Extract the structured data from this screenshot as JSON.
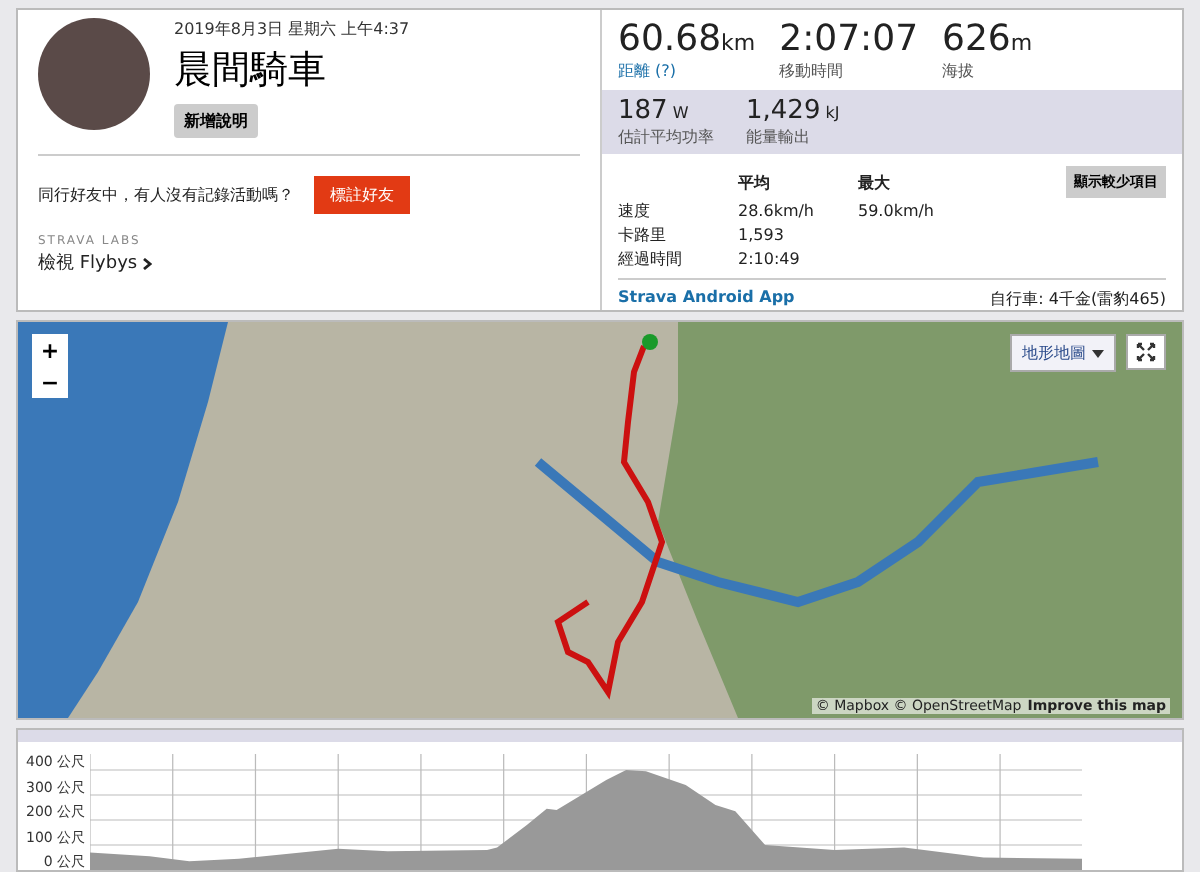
{
  "activity": {
    "date": "2019年8月3日 星期六 上午4:37",
    "title": "晨間騎車",
    "add_description": "新增說明"
  },
  "friends": {
    "prompt": "同行好友中，有人沒有記錄活動嗎？",
    "button": "標註好友"
  },
  "labs": {
    "label": "STRAVA LABS",
    "link": "檢視 Flybys"
  },
  "stats": [
    {
      "value": "60.68",
      "unit": "km",
      "label": "距離 (?)",
      "kind": "link"
    },
    {
      "value": "2:07:07",
      "label": "移動時間",
      "kind": "plain"
    },
    {
      "value": "626",
      "unit": "m",
      "label": "海拔",
      "kind": "plain"
    }
  ],
  "secondary_stats": [
    {
      "value": "187",
      "unit": "W",
      "label": "估計平均功率"
    },
    {
      "value": "1,429",
      "unit": "kJ",
      "label": "能量輸出"
    }
  ],
  "details": {
    "columns": [
      "平均",
      "最大"
    ],
    "toggle": "顯示較少項目",
    "rows": [
      {
        "label": "速度",
        "avg": "28.6km/h",
        "max": "59.0km/h"
      },
      {
        "label": "卡路里",
        "avg": "1,593"
      },
      {
        "label": "經過時間",
        "avg": "2:10:49"
      }
    ]
  },
  "device": "Strava Android App",
  "bike": "自行車: 4千金(雷豹465)",
  "map": {
    "zoom_in": "+",
    "zoom_out": "−",
    "layer": "地形地圖",
    "attribution": "© Mapbox © OpenStreetMap",
    "improve": "Improve this map"
  },
  "elevation": {
    "yticks": [
      "400 公尺",
      "300 公尺",
      "200 公尺",
      "100 公尺",
      "0 公尺"
    ]
  }
}
